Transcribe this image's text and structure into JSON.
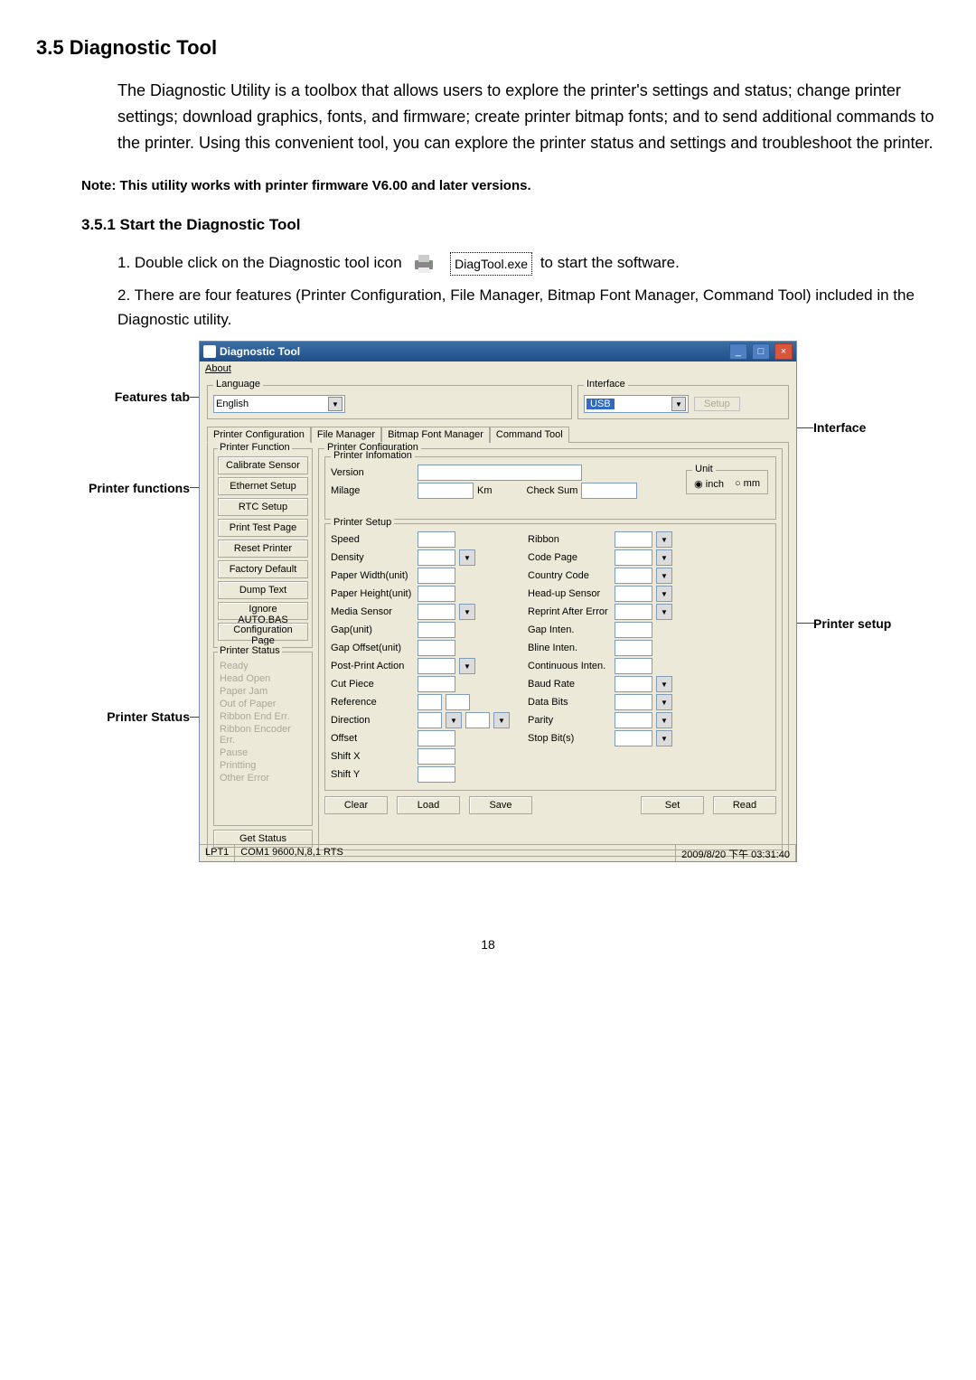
{
  "section": {
    "number": "3.5",
    "title": "Diagnostic Tool",
    "body": "The Diagnostic Utility is a toolbox that allows users to explore the printer's settings and status; change printer settings; download graphics, fonts, and firmware; create printer bitmap fonts; and to send additional commands to the printer. Using this convenient tool, you can explore the printer status and settings and troubleshoot the printer.",
    "note": "Note: This utility works with printer firmware V6.00 and later versions."
  },
  "subsection": {
    "number": "3.5.1",
    "title": "Start the Diagnostic Tool",
    "step1_pre": "1. Double click on the Diagnostic tool icon",
    "exe_name": "DiagTool.exe",
    "step1_post": "to start the software.",
    "step2": "2. There are four features (Printer Configuration, File Manager, Bitmap Font Manager, Command Tool) included in the Diagnostic utility."
  },
  "labels": {
    "features_tab": "Features tab",
    "printer_functions": "Printer functions",
    "printer_status": "Printer Status",
    "interface": "Interface",
    "printer_setup": "Printer setup"
  },
  "win": {
    "title": "Diagnostic Tool",
    "menu_about": "About",
    "language_legend": "Language",
    "language_value": "English",
    "interface_legend": "Interface",
    "interface_value": "USB",
    "setup_btn": "Setup",
    "tabs": [
      "Printer Configuration",
      "File Manager",
      "Bitmap Font Manager",
      "Command Tool"
    ],
    "pf_legend": "Printer Function",
    "pf_buttons": [
      "Calibrate Sensor",
      "Ethernet Setup",
      "RTC Setup",
      "Print Test Page",
      "Reset Printer",
      "Factory Default",
      "Dump Text",
      "Ignore AUTO.BAS",
      "Configuration Page"
    ],
    "ps_legend": "Printer Status",
    "ps_items": [
      "Ready",
      "Head Open",
      "Paper Jam",
      "Out of Paper",
      "Ribbon End Err.",
      "Ribbon Encoder Err.",
      "Pause",
      "Printting",
      "Other Error"
    ],
    "get_status": "Get Status",
    "pc_legend": "Printer Configuration",
    "pi_legend": "Printer Infomation",
    "version": "Version",
    "milage": "Milage",
    "km": "Km",
    "checksum": "Check Sum",
    "unit_legend": "Unit",
    "unit_inch": "inch",
    "unit_mm": "mm",
    "psu_legend": "Printer Setup",
    "left_labels": [
      "Speed",
      "Density",
      "Paper Width(unit)",
      "Paper Height(unit)",
      "Media Sensor",
      "Gap(unit)",
      "Gap Offset(unit)",
      "Post-Print Action",
      "Cut Piece",
      "Reference",
      "Direction",
      "Offset",
      "Shift X",
      "Shift Y"
    ],
    "right_labels": [
      "Ribbon",
      "Code Page",
      "Country Code",
      "Head-up Sensor",
      "Reprint After Error",
      "Gap Inten.",
      "Bline Inten.",
      "Continuous Inten.",
      "Baud Rate",
      "Data Bits",
      "Parity",
      "Stop Bit(s)"
    ],
    "bottom_buttons": [
      "Clear",
      "Load",
      "Save",
      "Set",
      "Read"
    ],
    "status_lpt": "LPT1",
    "status_com": "COM1 9600,N,8,1 RTS",
    "status_time": "2009/8/20 下午 03:31:40"
  },
  "page_number": "18"
}
